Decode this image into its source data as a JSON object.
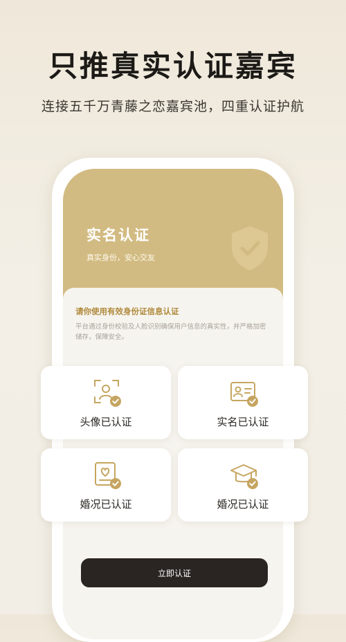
{
  "headline": "只推真实认证嘉宾",
  "subheadline": "连接五千万青藤之恋嘉宾池，四重认证护航",
  "header_card": {
    "title": "实名认证",
    "subtitle": "真实身份，安心交友"
  },
  "info": {
    "title": "请你使用有效身份证信息认证",
    "description": "平台通过身份校验及人脸识别确保用户信息的真实性，并严格加密储存，保障安全。"
  },
  "cards": [
    {
      "label": "头像已认证",
      "icon": "face-scan-icon"
    },
    {
      "label": "实名已认证",
      "icon": "id-card-icon"
    },
    {
      "label": "婚况已认证",
      "icon": "heart-document-icon"
    },
    {
      "label": "婚况已认证",
      "icon": "graduation-cap-icon"
    }
  ],
  "cta_label": "立即认证",
  "colors": {
    "gold": "#d2bb82",
    "icon_gold": "#c6a560",
    "dark_button": "#2a2522",
    "info_title": "#b08a3c"
  }
}
